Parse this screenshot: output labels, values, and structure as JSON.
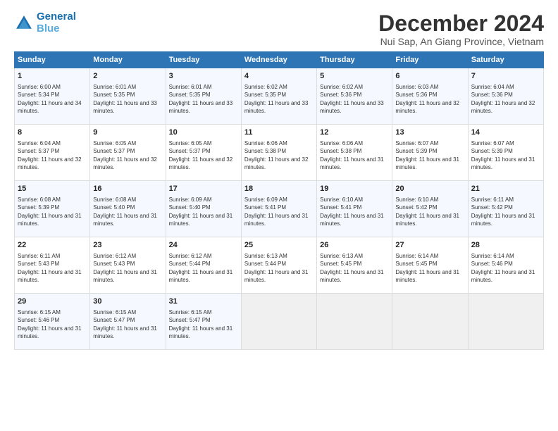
{
  "header": {
    "logo_line1": "General",
    "logo_line2": "Blue",
    "month": "December 2024",
    "location": "Nui Sap, An Giang Province, Vietnam"
  },
  "days_of_week": [
    "Sunday",
    "Monday",
    "Tuesday",
    "Wednesday",
    "Thursday",
    "Friday",
    "Saturday"
  ],
  "weeks": [
    [
      {
        "day": "1",
        "sunrise": "6:00 AM",
        "sunset": "5:34 PM",
        "daylight": "11 hours and 34 minutes."
      },
      {
        "day": "2",
        "sunrise": "6:01 AM",
        "sunset": "5:35 PM",
        "daylight": "11 hours and 33 minutes."
      },
      {
        "day": "3",
        "sunrise": "6:01 AM",
        "sunset": "5:35 PM",
        "daylight": "11 hours and 33 minutes."
      },
      {
        "day": "4",
        "sunrise": "6:02 AM",
        "sunset": "5:35 PM",
        "daylight": "11 hours and 33 minutes."
      },
      {
        "day": "5",
        "sunrise": "6:02 AM",
        "sunset": "5:36 PM",
        "daylight": "11 hours and 33 minutes."
      },
      {
        "day": "6",
        "sunrise": "6:03 AM",
        "sunset": "5:36 PM",
        "daylight": "11 hours and 32 minutes."
      },
      {
        "day": "7",
        "sunrise": "6:04 AM",
        "sunset": "5:36 PM",
        "daylight": "11 hours and 32 minutes."
      }
    ],
    [
      {
        "day": "8",
        "sunrise": "6:04 AM",
        "sunset": "5:37 PM",
        "daylight": "11 hours and 32 minutes."
      },
      {
        "day": "9",
        "sunrise": "6:05 AM",
        "sunset": "5:37 PM",
        "daylight": "11 hours and 32 minutes."
      },
      {
        "day": "10",
        "sunrise": "6:05 AM",
        "sunset": "5:37 PM",
        "daylight": "11 hours and 32 minutes."
      },
      {
        "day": "11",
        "sunrise": "6:06 AM",
        "sunset": "5:38 PM",
        "daylight": "11 hours and 32 minutes."
      },
      {
        "day": "12",
        "sunrise": "6:06 AM",
        "sunset": "5:38 PM",
        "daylight": "11 hours and 31 minutes."
      },
      {
        "day": "13",
        "sunrise": "6:07 AM",
        "sunset": "5:39 PM",
        "daylight": "11 hours and 31 minutes."
      },
      {
        "day": "14",
        "sunrise": "6:07 AM",
        "sunset": "5:39 PM",
        "daylight": "11 hours and 31 minutes."
      }
    ],
    [
      {
        "day": "15",
        "sunrise": "6:08 AM",
        "sunset": "5:39 PM",
        "daylight": "11 hours and 31 minutes."
      },
      {
        "day": "16",
        "sunrise": "6:08 AM",
        "sunset": "5:40 PM",
        "daylight": "11 hours and 31 minutes."
      },
      {
        "day": "17",
        "sunrise": "6:09 AM",
        "sunset": "5:40 PM",
        "daylight": "11 hours and 31 minutes."
      },
      {
        "day": "18",
        "sunrise": "6:09 AM",
        "sunset": "5:41 PM",
        "daylight": "11 hours and 31 minutes."
      },
      {
        "day": "19",
        "sunrise": "6:10 AM",
        "sunset": "5:41 PM",
        "daylight": "11 hours and 31 minutes."
      },
      {
        "day": "20",
        "sunrise": "6:10 AM",
        "sunset": "5:42 PM",
        "daylight": "11 hours and 31 minutes."
      },
      {
        "day": "21",
        "sunrise": "6:11 AM",
        "sunset": "5:42 PM",
        "daylight": "11 hours and 31 minutes."
      }
    ],
    [
      {
        "day": "22",
        "sunrise": "6:11 AM",
        "sunset": "5:43 PM",
        "daylight": "11 hours and 31 minutes."
      },
      {
        "day": "23",
        "sunrise": "6:12 AM",
        "sunset": "5:43 PM",
        "daylight": "11 hours and 31 minutes."
      },
      {
        "day": "24",
        "sunrise": "6:12 AM",
        "sunset": "5:44 PM",
        "daylight": "11 hours and 31 minutes."
      },
      {
        "day": "25",
        "sunrise": "6:13 AM",
        "sunset": "5:44 PM",
        "daylight": "11 hours and 31 minutes."
      },
      {
        "day": "26",
        "sunrise": "6:13 AM",
        "sunset": "5:45 PM",
        "daylight": "11 hours and 31 minutes."
      },
      {
        "day": "27",
        "sunrise": "6:14 AM",
        "sunset": "5:45 PM",
        "daylight": "11 hours and 31 minutes."
      },
      {
        "day": "28",
        "sunrise": "6:14 AM",
        "sunset": "5:46 PM",
        "daylight": "11 hours and 31 minutes."
      }
    ],
    [
      {
        "day": "29",
        "sunrise": "6:15 AM",
        "sunset": "5:46 PM",
        "daylight": "11 hours and 31 minutes."
      },
      {
        "day": "30",
        "sunrise": "6:15 AM",
        "sunset": "5:47 PM",
        "daylight": "11 hours and 31 minutes."
      },
      {
        "day": "31",
        "sunrise": "6:15 AM",
        "sunset": "5:47 PM",
        "daylight": "11 hours and 31 minutes."
      },
      null,
      null,
      null,
      null
    ]
  ]
}
